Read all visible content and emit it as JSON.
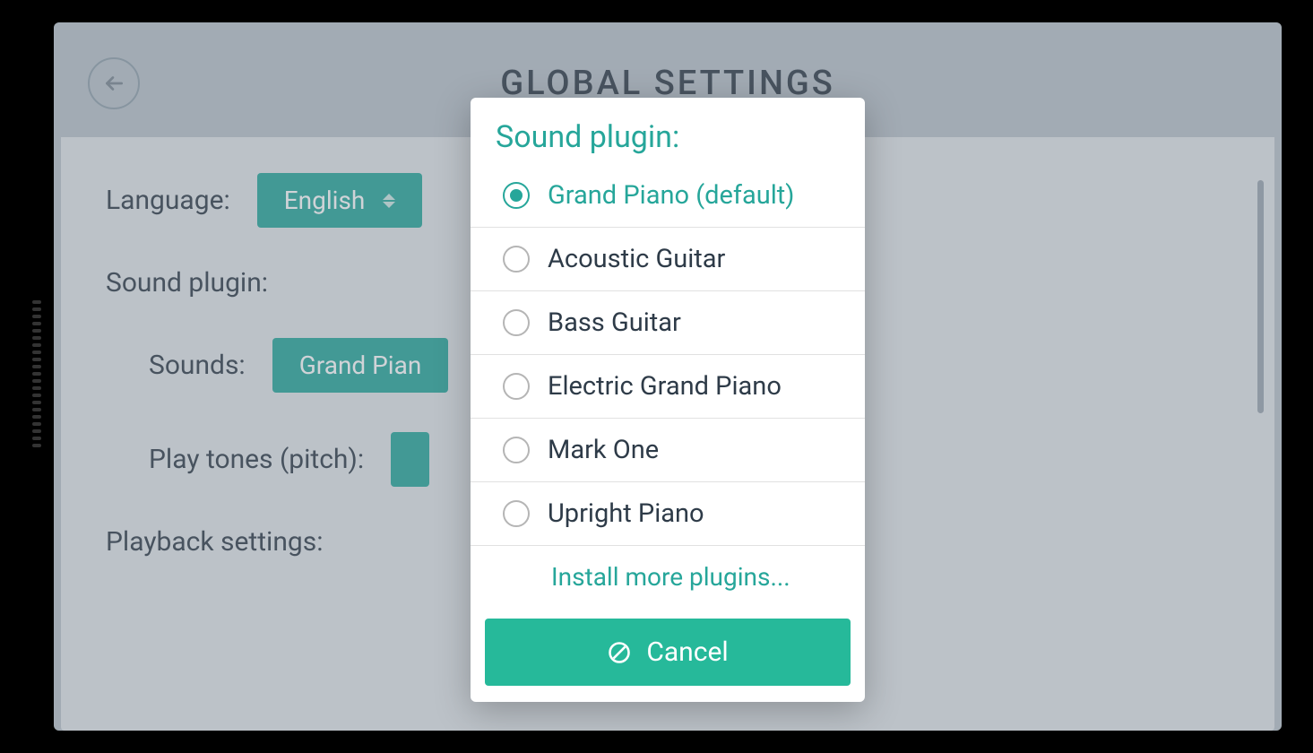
{
  "header": {
    "title": "GLOBAL SETTINGS"
  },
  "settings": {
    "language_label": "Language:",
    "language_value": "English",
    "sound_plugin_section_label": "Sound plugin:",
    "sounds_label": "Sounds:",
    "sounds_value": "Grand Pian",
    "play_tones_label": "Play tones (pitch):",
    "playback_section_label": "Playback settings:"
  },
  "modal": {
    "title": "Sound plugin:",
    "options": [
      {
        "label": "Grand Piano (default)",
        "selected": true
      },
      {
        "label": "Acoustic Guitar",
        "selected": false
      },
      {
        "label": "Bass Guitar",
        "selected": false
      },
      {
        "label": "Electric Grand Piano",
        "selected": false
      },
      {
        "label": "Mark One",
        "selected": false
      },
      {
        "label": "Upright Piano",
        "selected": false
      }
    ],
    "install_more_label": "Install more plugins...",
    "cancel_label": "Cancel"
  }
}
